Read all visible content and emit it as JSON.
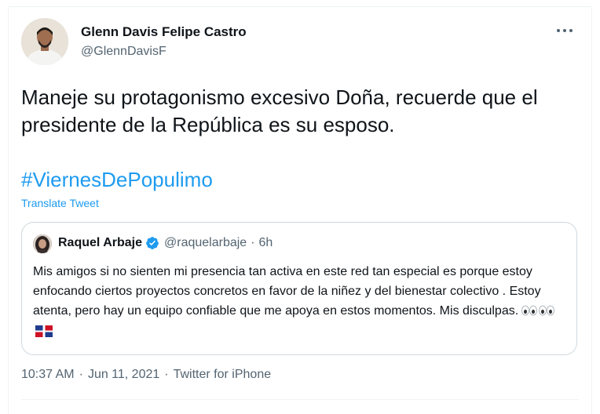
{
  "tweet": {
    "author_name": "Glenn Davis Felipe Castro",
    "author_handle": "@GlennDavisF",
    "text": "Maneje su protagonismo excesivo Doña, recuerde que el presidente de la República es su esposo.",
    "hashtag": "#ViernesDePopulimo",
    "translate_label": "Translate Tweet",
    "time": "10:37 AM",
    "date": "Jun 11, 2021",
    "source": "Twitter for iPhone",
    "separator": "·"
  },
  "quote": {
    "author_name": "Raquel Arbaje",
    "author_handle": "@raquelarbaje",
    "separator": "·",
    "time_ago": "6h",
    "text": "Mis amigos si no sienten mi presencia tan activa en este red tan especial es porque estoy enfocando ciertos proyectos concretos en favor de la niñez y del bienestar colectivo . Estoy atenta, pero hay un equipo confiable que me apoya en estos momentos. Mis disculpas."
  },
  "icons": {
    "more": "more-options-icon",
    "verified": "verified-badge-icon",
    "eyes": "eyes-emoji-icon",
    "flag": "dominican-flag-icon"
  },
  "colors": {
    "accent": "#1d9bf0",
    "text": "#0f1419",
    "secondary": "#536471",
    "border": "#cfd9de"
  }
}
